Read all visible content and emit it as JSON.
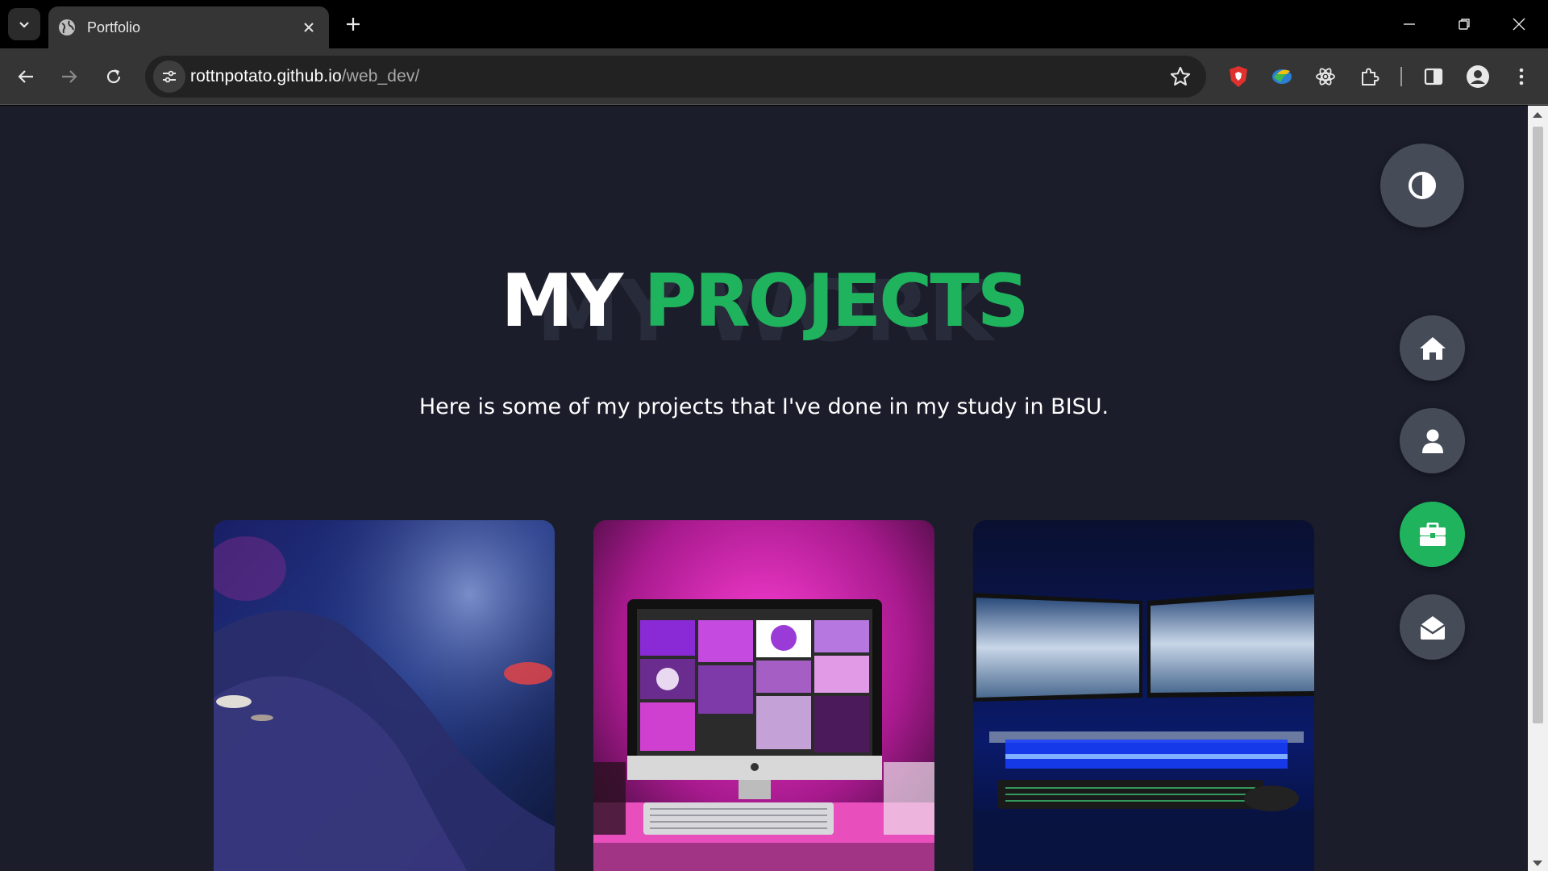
{
  "browser": {
    "tab_title": "Portfolio",
    "url_host": "rottnpotato.github.io",
    "url_path": "/web_dev/"
  },
  "page": {
    "heading_shadow": "MY WORK",
    "heading_white": "MY",
    "heading_green": "PROJECTS",
    "subtitle": "Here is some of my projects that I've done in my study in BISU."
  },
  "side_nav": {
    "theme_icon": "contrast-icon",
    "items": [
      {
        "icon": "home-icon",
        "active": false
      },
      {
        "icon": "user-icon",
        "active": false
      },
      {
        "icon": "briefcase-icon",
        "active": true
      },
      {
        "icon": "mail-open-icon",
        "active": false
      }
    ]
  },
  "projects": [
    {
      "image": "hand-on-glowing-keyboard"
    },
    {
      "image": "imac-pink-neon-desk"
    },
    {
      "image": "dual-monitor-blue-setup"
    }
  ],
  "colors": {
    "accent": "#1fb35e",
    "page_bg": "#1b1d2b",
    "nav_btn": "#464b58"
  }
}
